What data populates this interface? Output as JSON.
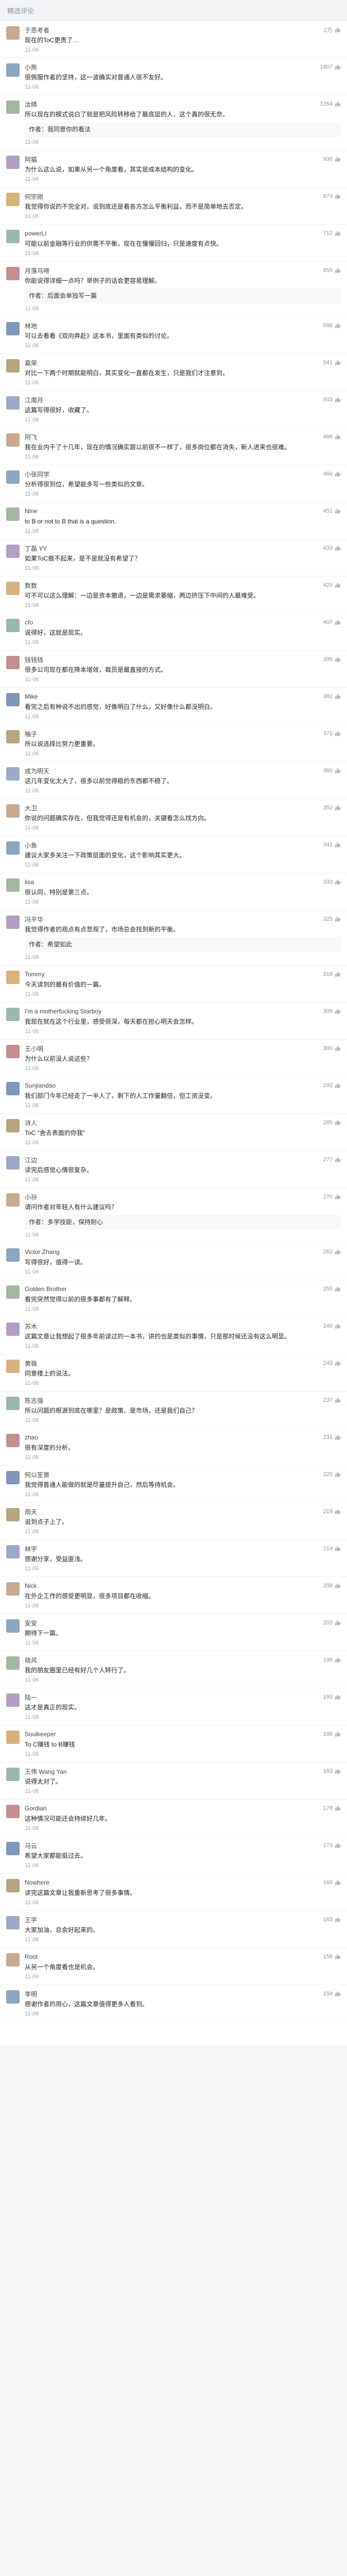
{
  "header": {
    "title": "精选评论"
  },
  "like_icon_name": "thumbs-up-icon",
  "comments": [
    {
      "name": "于思考者",
      "likes": "2万",
      "body": "现在的ToC更贵了…",
      "time": "11-06",
      "reply": ""
    },
    {
      "name": "小熊",
      "likes": "1807",
      "body": "很佩服作者的坚持，这一波确实对普通人很不友好。",
      "time": "11-06",
      "reply": ""
    },
    {
      "name": "汝晴",
      "likes": "1264",
      "body": "所以现在的模式说白了就是把风险转移给了最底层的人，这个真的很无奈。",
      "time": "11-06",
      "reply": "作者：我同意你的看法"
    },
    {
      "name": "阿猫",
      "likes": "936",
      "body": "为什么这么说，如果从另一个角度看，其实是成本结构的变化。",
      "time": "11-06",
      "reply": ""
    },
    {
      "name": "何宗刚",
      "likes": "874",
      "body": "我觉得你说的不完全对。说到底还是看各方怎么平衡利益，而不是简单地去否定。",
      "time": "11-06",
      "reply": ""
    },
    {
      "name": "powerLi",
      "likes": "712",
      "body": "可能以前金融等行业的供需不平衡，现在在慢慢回归，只是速度有点快。",
      "time": "11-06",
      "reply": ""
    },
    {
      "name": "月落乌啼",
      "likes": "655",
      "body": "你能说得详细一点吗？举例子的话会更容易理解。",
      "time": "11-06",
      "reply": "作者：后面会单独写一篇"
    },
    {
      "name": "林地",
      "likes": "598",
      "body": "可以去看看《双向奔赴》这本书，里面有类似的讨论。",
      "time": "11-06",
      "reply": ""
    },
    {
      "name": "嘉荣",
      "likes": "541",
      "body": "对比一下两个时期就能明白，其实变化一直都在发生，只是我们才注意到。",
      "time": "11-06",
      "reply": ""
    },
    {
      "name": "江南月",
      "likes": "503",
      "body": "这篇写得很好，收藏了。",
      "time": "11-06",
      "reply": ""
    },
    {
      "name": "阿飞",
      "likes": "488",
      "body": "我在业内干了十几年，现在的情况确实跟以前很不一样了，很多岗位都在消失，新人进来也很难。",
      "time": "11-06",
      "reply": ""
    },
    {
      "name": "小张同学",
      "likes": "466",
      "body": "分析得很到位，希望能多写一些类似的文章。",
      "time": "11-06",
      "reply": ""
    },
    {
      "name": "Nine",
      "likes": "451",
      "body": "to B or not to B that is a question.",
      "time": "11-06",
      "reply": ""
    },
    {
      "name": "丁磊 YY",
      "likes": "433",
      "body": "如果ToC做不起来，是不是就没有希望了？",
      "time": "11-06",
      "reply": ""
    },
    {
      "name": "数数",
      "likes": "420",
      "body": "可不可以这么理解：一边是资本撤退，一边是需求萎缩，两边挤压下中间的人最难受。",
      "time": "11-06",
      "reply": ""
    },
    {
      "name": "cfo",
      "likes": "407",
      "body": "说得好，这就是现实。",
      "time": "11-06",
      "reply": ""
    },
    {
      "name": "钱钱钱",
      "likes": "395",
      "body": "很多公司现在都在降本增效，裁员是最直接的方式。",
      "time": "11-06",
      "reply": ""
    },
    {
      "name": "Mike",
      "likes": "382",
      "body": "看完之后有种说不出的感觉，好像明白了什么，又好像什么都没明白。",
      "time": "11-06",
      "reply": ""
    },
    {
      "name": "柚子",
      "likes": "371",
      "body": "所以说选择比努力更重要。",
      "time": "11-06",
      "reply": ""
    },
    {
      "name": "成为明天",
      "likes": "360",
      "body": "这几年变化太大了，很多以前觉得稳的东西都不稳了。",
      "time": "11-06",
      "reply": ""
    },
    {
      "name": "大卫",
      "likes": "352",
      "body": "你说的问题确实存在，但我觉得还是有机会的，关键看怎么找方向。",
      "time": "11-06",
      "reply": ""
    },
    {
      "name": "小鱼",
      "likes": "341",
      "body": "建议大家多关注一下政策层面的变化，这个影响其实更大。",
      "time": "11-06",
      "reply": ""
    },
    {
      "name": "lisa",
      "likes": "333",
      "body": "很认同，特别是第三点。",
      "time": "11-06",
      "reply": ""
    },
    {
      "name": "冯平华",
      "likes": "325",
      "body": "我觉得作者的观点有点悲观了，市场总会找到新的平衡。",
      "time": "11-06",
      "reply": "作者：希望如此"
    },
    {
      "name": "Tommy",
      "likes": "318",
      "body": "今天读到的最有价值的一篇。",
      "time": "11-06",
      "reply": ""
    },
    {
      "name": "I'm a motherfucking Starboy",
      "likes": "309",
      "body": "我现在就在这个行业里，感受很深，每天都在担心明天会怎样。",
      "time": "11-06",
      "reply": ""
    },
    {
      "name": "王小明",
      "likes": "300",
      "body": "为什么以前没人说这些？",
      "time": "11-06",
      "reply": ""
    },
    {
      "name": "Sunjiandao",
      "likes": "292",
      "body": "我们部门今年已经走了一半人了，剩下的人工作量翻倍，但工资没变。",
      "time": "11-06",
      "reply": ""
    },
    {
      "name": "诗人",
      "likes": "285",
      "body": "ToC \"舍去表面的你我\"",
      "time": "11-06",
      "reply": ""
    },
    {
      "name": "江边",
      "likes": "277",
      "body": "读完后感觉心情很复杂。",
      "time": "11-06",
      "reply": ""
    },
    {
      "name": "小孙",
      "likes": "270",
      "body": "请问作者对年轻人有什么建议吗？",
      "time": "11-06",
      "reply": "作者：多学技能，保持耐心"
    },
    {
      "name": "Victor Zhang",
      "likes": "262",
      "body": "写得很好，值得一读。",
      "time": "11-06",
      "reply": ""
    },
    {
      "name": "Golden Brother",
      "likes": "255",
      "body": "看完突然觉得以前的很多事都有了解释。",
      "time": "11-06",
      "reply": ""
    },
    {
      "name": "苏木",
      "likes": "249",
      "body": "这篇文章让我想起了很多年前读过的一本书，讲的也是类似的事情，只是那时候还没有这么明显。",
      "time": "11-06",
      "reply": ""
    },
    {
      "name": "黄薇",
      "likes": "243",
      "body": "同意楼上的说法。",
      "time": "11-06",
      "reply": ""
    },
    {
      "name": "陈志强",
      "likes": "237",
      "body": "所以问题的根源到底在哪里？是政策、是市场，还是我们自己？",
      "time": "11-06",
      "reply": ""
    },
    {
      "name": "zhao",
      "likes": "231",
      "body": "很有深度的分析。",
      "time": "11-06",
      "reply": ""
    },
    {
      "name": "何以笙箫",
      "likes": "225",
      "body": "我觉得普通人能做的就是尽量提升自己，然后等待机会。",
      "time": "11-06",
      "reply": ""
    },
    {
      "name": "雨天",
      "likes": "219",
      "body": "说到点子上了。",
      "time": "11-06",
      "reply": ""
    },
    {
      "name": "林宇",
      "likes": "214",
      "body": "感谢分享，受益匪浅。",
      "time": "11-06",
      "reply": ""
    },
    {
      "name": "Nick",
      "likes": "208",
      "body": "在外企工作的感受更明显，很多项目都在收缩。",
      "time": "11-06",
      "reply": ""
    },
    {
      "name": "安安",
      "likes": "203",
      "body": "期待下一篇。",
      "time": "11-06",
      "reply": ""
    },
    {
      "name": "晓风",
      "likes": "198",
      "body": "我的朋友圈里已经有好几个人转行了。",
      "time": "11-06",
      "reply": ""
    },
    {
      "name": "陆一",
      "likes": "193",
      "body": "这才是真正的现实。",
      "time": "11-06",
      "reply": ""
    },
    {
      "name": "Soulkeeper",
      "likes": "188",
      "body": "To C赚钱 to B赚钱",
      "time": "11-06",
      "reply": ""
    },
    {
      "name": "王伟 Wang Yan",
      "likes": "183",
      "body": "说得太对了。",
      "time": "11-06",
      "reply": ""
    },
    {
      "name": "Gordian",
      "likes": "178",
      "body": "这种情况可能还会持续好几年。",
      "time": "11-06",
      "reply": ""
    },
    {
      "name": "马云",
      "likes": "173",
      "body": "希望大家都能挺过去。",
      "time": "11-06",
      "reply": ""
    },
    {
      "name": "Nowhere",
      "likes": "168",
      "body": "读完这篇文章让我重新思考了很多事情。",
      "time": "11-06",
      "reply": ""
    },
    {
      "name": "王宇",
      "likes": "163",
      "body": "大家加油，总会好起来的。",
      "time": "11-06",
      "reply": ""
    },
    {
      "name": "Root",
      "likes": "158",
      "body": "从另一个角度看也是机会。",
      "time": "11-06",
      "reply": ""
    },
    {
      "name": "李明",
      "likes": "154",
      "body": "感谢作者的用心，这篇文章值得更多人看到。",
      "time": "11-06",
      "reply": ""
    }
  ],
  "footer": {
    "text": ""
  }
}
